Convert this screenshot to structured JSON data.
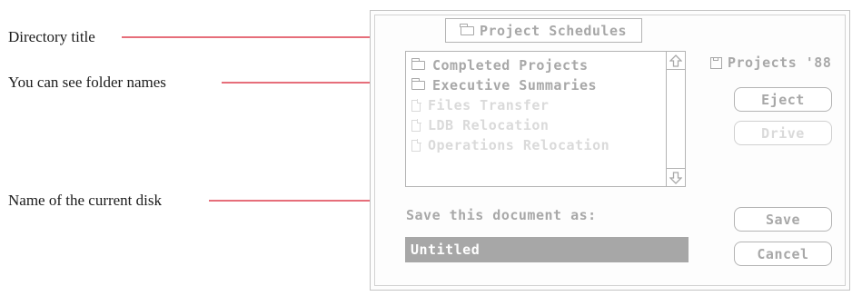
{
  "callouts": {
    "directory_title": "Directory title",
    "folder_names": "You can see folder names",
    "current_disk": "Name of the current disk"
  },
  "dialog": {
    "directory_popup": "Project Schedules",
    "file_list": [
      {
        "label": "Completed Projects",
        "kind": "folder",
        "enabled": true
      },
      {
        "label": "Executive Summaries",
        "kind": "folder",
        "enabled": true
      },
      {
        "label": "Files Transfer",
        "kind": "document",
        "enabled": false
      },
      {
        "label": "LDB Relocation",
        "kind": "document",
        "enabled": false
      },
      {
        "label": "Operations Relocation",
        "kind": "document",
        "enabled": false
      }
    ],
    "disk_name": "Projects '88",
    "buttons": {
      "eject": "Eject",
      "drive": "Drive",
      "save": "Save",
      "cancel": "Cancel"
    },
    "save_prompt": "Save this document as:",
    "filename_value": "Untitled"
  },
  "colors": {
    "leader_line": "#d8182a",
    "ui_text": "#a8a8a8",
    "ui_text_disabled": "#dadada",
    "selection": "#a7a7a7"
  },
  "icons": {
    "popup": "folder-icon",
    "disk": "disk-icon",
    "scroll_up": "up-arrow-icon",
    "scroll_down": "down-arrow-icon"
  }
}
